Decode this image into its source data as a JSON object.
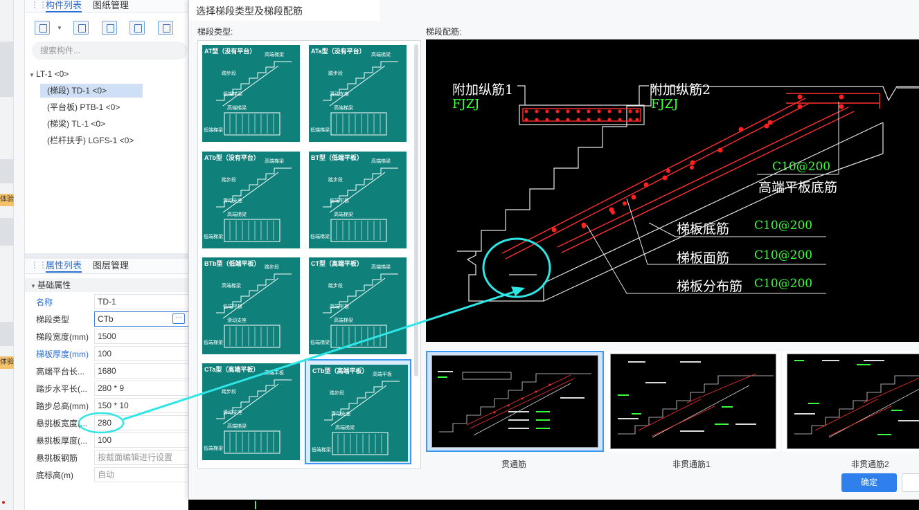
{
  "left_strip": {
    "tag1": "体验",
    "tag2": "体验"
  },
  "component_panel": {
    "tabs": [
      "构件列表",
      "图纸管理"
    ],
    "search_placeholder": "搜索构件...",
    "tree": {
      "root": "LT-1 <0>",
      "items": [
        "(梯段) TD-1 <0>",
        "(平台板) PTB-1 <0>",
        "(梯梁) TL-1 <0>",
        "(栏杆扶手) LGFS-1 <0>"
      ]
    }
  },
  "property_panel": {
    "tabs": [
      "属性列表",
      "图层管理"
    ],
    "section": "基础属性",
    "rows": [
      {
        "label": "名称",
        "value": "TD-1"
      },
      {
        "label": "梯段类型",
        "value": "CTb"
      },
      {
        "label": "梯段宽度(mm)",
        "value": "1500"
      },
      {
        "label": "梯板厚度(mm)",
        "value": "100"
      },
      {
        "label": "高端平台长...",
        "value": "1680"
      },
      {
        "label": "踏步水平长(...",
        "value": "280 * 9"
      },
      {
        "label": "踏步总高(mm)",
        "value": "150 * 10"
      },
      {
        "label": "悬挑板宽度(...",
        "value": "280"
      },
      {
        "label": "悬挑板厚度(...",
        "value": "100"
      },
      {
        "label": "悬挑板钢筋",
        "value": "按截面编辑进行设置"
      },
      {
        "label": "底标高(m)",
        "value": "自动"
      }
    ]
  },
  "dialog": {
    "title": "选择梯段类型及梯段配筋",
    "type_label": "梯段类型:",
    "rebar_label": "梯段配筋:",
    "types": [
      {
        "title": "AT型（没有平台）",
        "labels": [
          "高端梯梁",
          "踏步段",
          "低端梯梁",
          "高端梯梁",
          "低端梯梁"
        ]
      },
      {
        "title": "ATa型（没有平台）",
        "labels": [
          "高端梯梁",
          "踏步段",
          "滑动支座",
          "高端梯梁",
          "低端梯梁"
        ]
      },
      {
        "title": "ATb型（没有平台）",
        "labels": [
          "高端梯梁",
          "踏步段",
          "滑动支座",
          "高端梯梁",
          "低端梯梁"
        ]
      },
      {
        "title": "BT型（低端平板）",
        "labels": [
          "高端梯梁",
          "踏步段",
          "低端平板",
          "高端梯梁",
          "低端梯梁"
        ]
      },
      {
        "title": "BTb型（低端平板）",
        "labels": [
          "踏步段",
          "高端梯梁",
          "低端平板",
          "滑动支座",
          "低端梯梁"
        ]
      },
      {
        "title": "CT型（高端平板）",
        "labels": [
          "高端梯梁",
          "踏步段",
          "高端平板",
          "高端梯梁",
          "低端梯梁"
        ]
      },
      {
        "title": "CTa型（高端平板）",
        "labels": [
          "高端平板",
          "踏步段",
          "滑动支座",
          "高端梯梁",
          "低端梯梁"
        ]
      },
      {
        "title": "CTb型（高端平板）",
        "labels": [
          "高端平板",
          "踏步段",
          "滑动支座",
          "高端梯梁",
          "低端梯梁"
        ]
      }
    ],
    "preview": {
      "add1": "附加纵筋1",
      "add1_code": "FJZJ",
      "add2": "附加纵筋2",
      "add2_code": "FJZJ",
      "high_code": "C10@200",
      "high_label": "高端平板底筋",
      "bottom_label": "梯板底筋",
      "bottom_code": "C10@200",
      "top_label": "梯板面筋",
      "top_code": "C10@200",
      "dist_label": "梯板分布筋",
      "dist_code": "C10@200"
    },
    "thumbs": [
      "贯通筋",
      "非贯通筋1",
      "非贯通筋2"
    ],
    "ok": "确定"
  }
}
